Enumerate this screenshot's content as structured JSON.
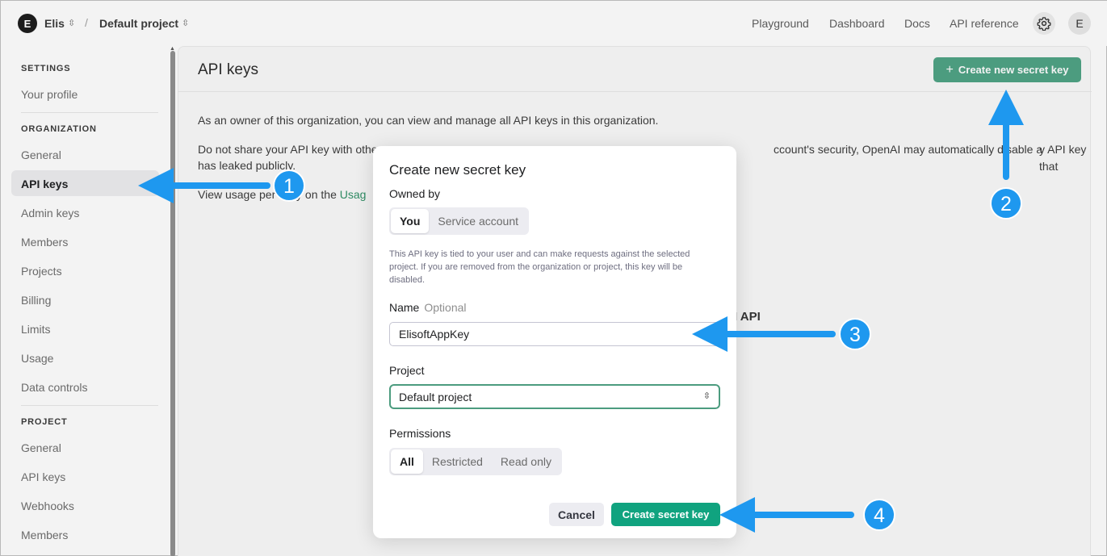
{
  "topbar": {
    "org_initial": "E",
    "org_name": "Elis",
    "separator": "/",
    "project_name": "Default project",
    "nav": [
      "Playground",
      "Dashboard",
      "Docs",
      "API reference"
    ],
    "user_initial": "E"
  },
  "sidebar": {
    "settings_header": "SETTINGS",
    "settings_items": [
      "Your profile"
    ],
    "organization_header": "ORGANIZATION",
    "organization_items": [
      "General",
      "API keys",
      "Admin keys",
      "Members",
      "Projects",
      "Billing",
      "Limits",
      "Usage",
      "Data controls"
    ],
    "active_item": "API keys",
    "project_header": "PROJECT",
    "project_items": [
      "General",
      "API keys",
      "Webhooks",
      "Members"
    ]
  },
  "main": {
    "title": "API keys",
    "create_button": "Create new secret key",
    "para1": "As an owner of this organization, you can view and manage all API keys in this organization.",
    "para2_start": "Do not share your API key with othe",
    "para2_end": "ccount's security, OpenAI may automatically disable a",
    "para2_tail": "y API key that",
    "para2_line2": "has leaked publicly.",
    "para3_start": "View usage per",
    "para3_mid": "ey on the ",
    "para3_link": "Usag",
    "background_heading": "I API"
  },
  "dialog": {
    "title": "Create new secret key",
    "owned_by_label": "Owned by",
    "owned_by_options": [
      "You",
      "Service account"
    ],
    "owned_by_selected": "You",
    "help_text": "This API key is tied to your user and can make requests against the selected project. If you are removed from the organization or project, this key will be disabled.",
    "name_label": "Name",
    "name_optional": "Optional",
    "name_value": "ElisoftAppKey",
    "project_label": "Project",
    "project_value": "Default project",
    "permissions_label": "Permissions",
    "permissions_options": [
      "All",
      "Restricted",
      "Read only"
    ],
    "permissions_selected": "All",
    "cancel_button": "Cancel",
    "create_button": "Create secret key"
  },
  "annotations": {
    "badges": [
      "1",
      "2",
      "3",
      "4"
    ],
    "color": "#1e98ef"
  },
  "colors": {
    "accent_green": "#10a37f",
    "muted_green": "#4c9c7f"
  }
}
